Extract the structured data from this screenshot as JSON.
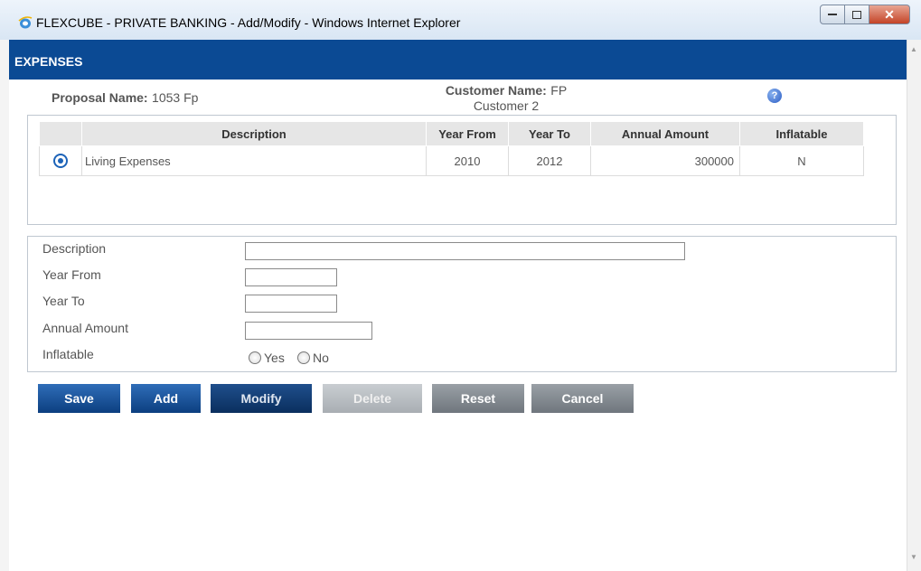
{
  "window": {
    "title": "FLEXCUBE - PRIVATE BANKING - Add/Modify - Windows Internet Explorer",
    "icon": "ie-icon"
  },
  "header": {
    "title": "EXPENSES"
  },
  "info": {
    "proposal_label": "Proposal Name:",
    "proposal_value": "1053 Fp",
    "customer_label": "Customer Name:",
    "customer_value_1": "FP",
    "customer_value_2": "Customer 2"
  },
  "grid": {
    "columns": [
      "Description",
      "Year From",
      "Year To",
      "Annual Amount",
      "Inflatable"
    ],
    "rows": [
      {
        "description": "Living Expenses",
        "year_from": "2010",
        "year_to": "2012",
        "annual_amount": "300000",
        "inflatable": "N"
      }
    ]
  },
  "form": {
    "description_label": "Description",
    "year_from_label": "Year From",
    "year_to_label": "Year To",
    "annual_amount_label": "Annual Amount",
    "inflatable_label": "Inflatable",
    "yes_label": "Yes",
    "no_label": "No",
    "description_value": "",
    "year_from_value": "",
    "year_to_value": "",
    "annual_amount_value": ""
  },
  "buttons": {
    "save": "Save",
    "add": "Add",
    "modify": "Modify",
    "delete": "Delete",
    "reset": "Reset",
    "cancel": "Cancel"
  }
}
